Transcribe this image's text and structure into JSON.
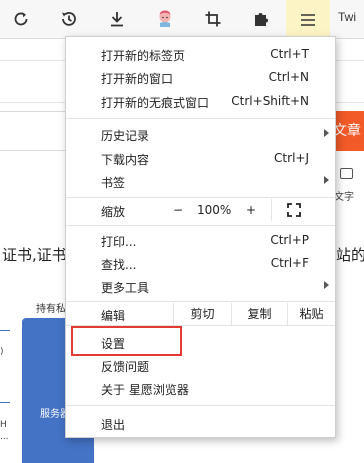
{
  "toolbar": {
    "buttons": [
      {
        "name": "refresh",
        "icon": "refresh-icon"
      },
      {
        "name": "history",
        "icon": "history-icon"
      },
      {
        "name": "download",
        "icon": "download-icon"
      },
      {
        "name": "avatar",
        "icon": "avatar-icon"
      },
      {
        "name": "crop",
        "icon": "crop-icon"
      },
      {
        "name": "extensions",
        "icon": "puzzle-icon"
      },
      {
        "name": "menu",
        "icon": "hamburger-menu-icon"
      }
    ],
    "tab_text": "Twi",
    "accent_color": "#fdf4c5"
  },
  "background": {
    "orange_button_text": "文章",
    "icon_label": "文字",
    "cert_text": "证书,证书",
    "cert_text_right": "站的",
    "holder_text": "持有私",
    "service_text": "服务器",
    "small_labels": [
      ")",
      "H",
      "..."
    ],
    "brand_orange": "#f25a28",
    "diagram_blue": "#4472c4"
  },
  "menu": {
    "new_tab": {
      "label": "打开新的标签页",
      "shortcut": "Ctrl+T"
    },
    "new_window": {
      "label": "打开新的窗口",
      "shortcut": "Ctrl+N"
    },
    "new_incognito": {
      "label": "打开新的无痕式窗口",
      "shortcut": "Ctrl+Shift+N"
    },
    "history": {
      "label": "历史记录"
    },
    "downloads": {
      "label": "下载内容",
      "shortcut": "Ctrl+J"
    },
    "bookmarks": {
      "label": "书签"
    },
    "zoom": {
      "label": "缩放",
      "minus": "−",
      "value": "100%",
      "plus": "+"
    },
    "print": {
      "label": "打印...",
      "shortcut": "Ctrl+P"
    },
    "find": {
      "label": "查找...",
      "shortcut": "Ctrl+F"
    },
    "more_tools": {
      "label": "更多工具"
    },
    "edit": {
      "label": "编辑",
      "cut": "剪切",
      "copy": "复制",
      "paste": "粘贴"
    },
    "settings": {
      "label": "设置"
    },
    "feedback": {
      "label": "反馈问题"
    },
    "about": {
      "label": "关于 星愿浏览器"
    },
    "exit": {
      "label": "退出"
    },
    "highlight_color": "#e53935"
  }
}
